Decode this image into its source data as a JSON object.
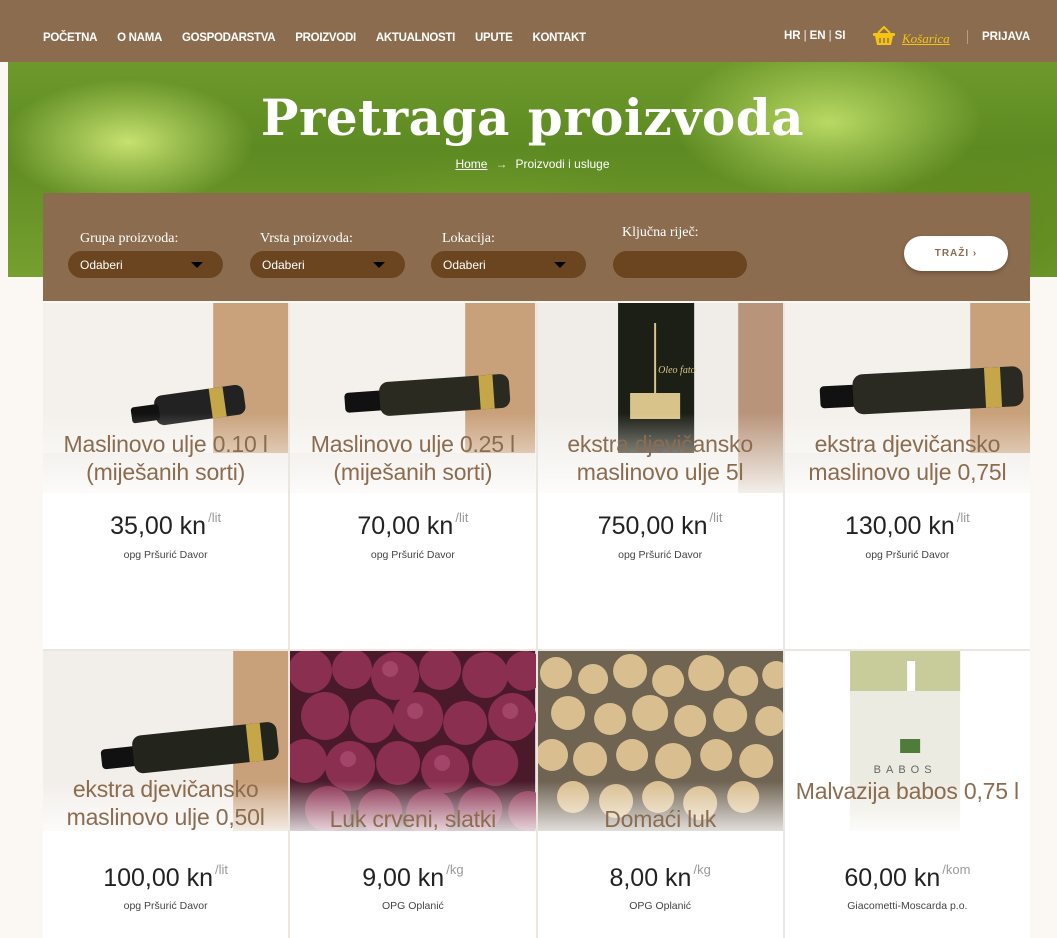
{
  "nav": {
    "items": [
      "POČETNA",
      "O NAMA",
      "GOSPODARSTVA",
      "PROIZVODI",
      "AKTUALNOSTI",
      "UPUTE",
      "KONTAKT"
    ],
    "langs": [
      "HR",
      "EN",
      "SI"
    ],
    "cart_label": "Košarica",
    "cart_icon": "basket-icon",
    "login_label": "PRIJAVA"
  },
  "hero": {
    "title": "Pretraga proizvoda",
    "breadcrumb_home": "Home",
    "breadcrumb_arrow": "→",
    "breadcrumb_current": "Proizvodi i usluge"
  },
  "filters": {
    "group_label": "Grupa proizvoda:",
    "group_value": "Odaberi",
    "type_label": "Vrsta proizvoda:",
    "type_value": "Odaberi",
    "location_label": "Lokacija:",
    "location_value": "Odaberi",
    "keyword_label": "Ključna riječ:",
    "keyword_value": "",
    "search_button": "TRAŽI ›"
  },
  "products": [
    {
      "title": "Maslinovo ulje 0.10 l (miješanih sorti)",
      "price": "35,00 kn",
      "unit": "/lit",
      "seller": "opg Pršurić Davor"
    },
    {
      "title": "Maslinovo ulje 0.25 l (miješanih sorti)",
      "price": "70,00 kn",
      "unit": "/lit",
      "seller": "opg Pršurić Davor"
    },
    {
      "title": "ekstra djevičansko maslinovo ulje 5l",
      "price": "750,00 kn",
      "unit": "/lit",
      "seller": "opg Pršurić Davor"
    },
    {
      "title": "ekstra djevičansko maslinovo ulje 0,75l",
      "price": "130,00 kn",
      "unit": "/lit",
      "seller": "opg Pršurić Davor"
    },
    {
      "title": "ekstra djevičansko maslinovo ulje 0,50l",
      "price": "100,00 kn",
      "unit": "/lit",
      "seller": "opg Pršurić Davor"
    },
    {
      "title": "Luk crveni, slatki",
      "price": "9,00 kn",
      "unit": "/kg",
      "seller": "OPG Oplanić"
    },
    {
      "title": "Domaći luk",
      "price": "8,00 kn",
      "unit": "/kg",
      "seller": "OPG Oplanić"
    },
    {
      "title": "Malvazija babos 0,75 l",
      "price": "60,00 kn",
      "unit": "/kom",
      "seller": "Giacometti-Moscarda p.o."
    }
  ],
  "bottle_label": {
    "brand": "Oleo fato",
    "wine_brand": "BABOS"
  }
}
